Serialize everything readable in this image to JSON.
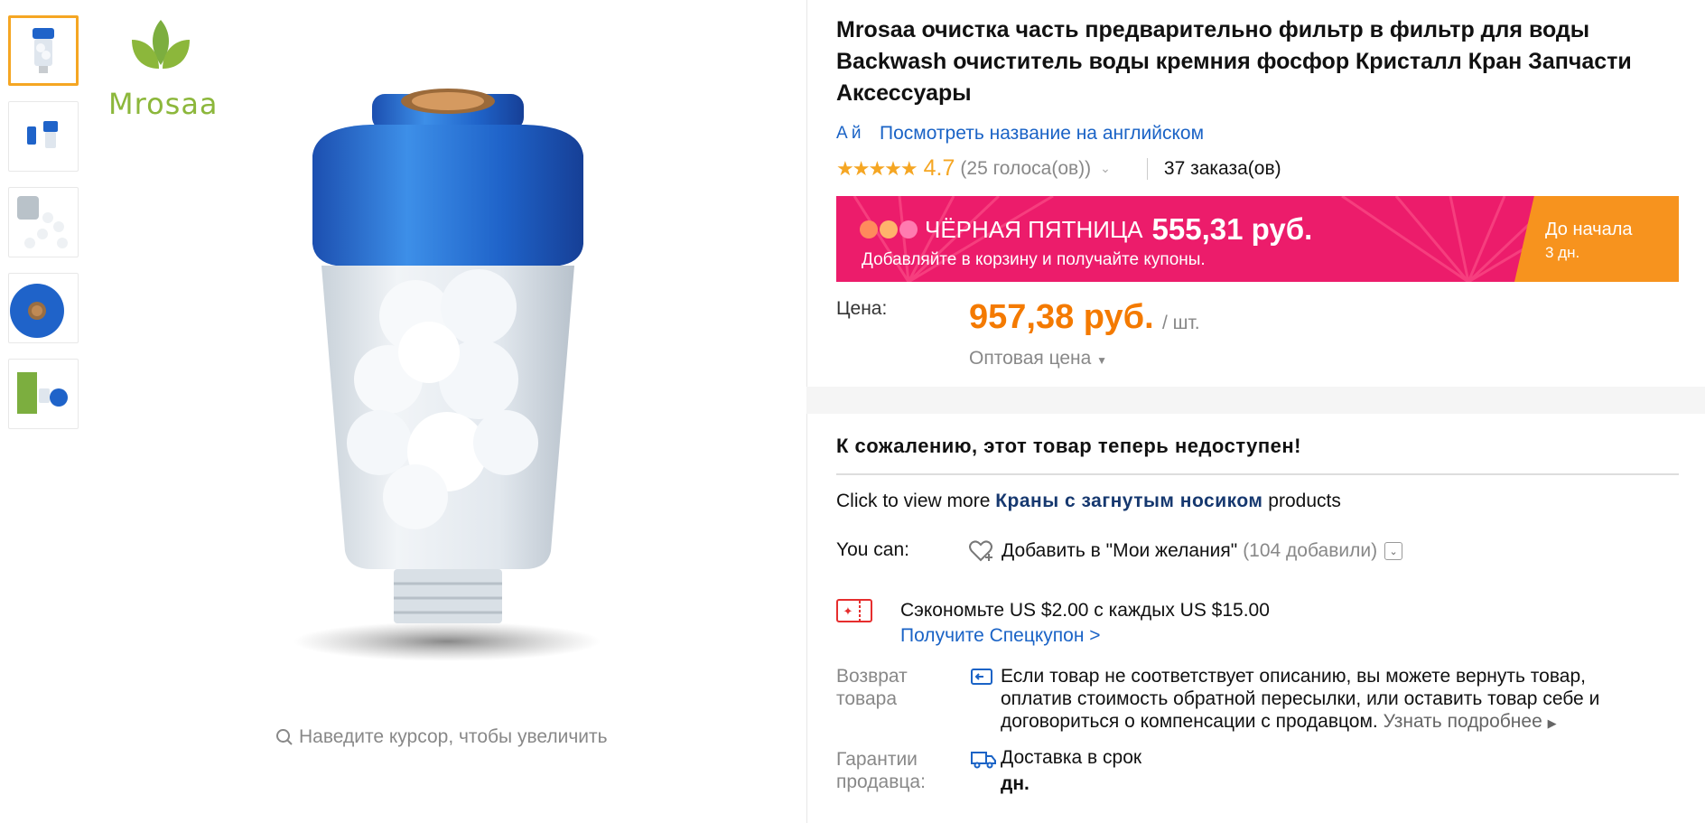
{
  "brand": {
    "name": "Mrosaa"
  },
  "gallery": {
    "thumbnails": [
      "thumb-1",
      "thumb-2",
      "thumb-3",
      "thumb-4",
      "thumb-5"
    ],
    "zoom_hint": "Наведите курсор, чтобы увеличить"
  },
  "product": {
    "title": "Mrosaa очистка часть предварительно фильтр в фильтр для воды Backwash очиститель воды кремния фосфор Кристалл Кран Запчасти Аксессуары",
    "translate_link": "Посмотреть название на английском",
    "translate_icon_text": "A й",
    "rating": {
      "stars": "★★★★★",
      "value": "4.7",
      "votes": "(25 голоса(ов))",
      "orders": "37 заказа(ов)"
    }
  },
  "promo": {
    "label": "ЧЁРНАЯ ПЯТНИЦА",
    "price": "555,31 руб.",
    "subtitle": "Добавляйте в корзину и получайте купоны.",
    "timer_label": "До начала",
    "timer_value": "3 дн.",
    "colors": {
      "banner": "#ec1c6b",
      "timer": "#f7931e"
    }
  },
  "price": {
    "label": "Цена:",
    "value": "957,38 руб.",
    "unit": "/ шт.",
    "wholesale": "Оптовая цена"
  },
  "availability": {
    "unavailable_message": "К сожалению, этот товар теперь недоступен!",
    "more_prefix": "Click to view more",
    "more_link": "Краны с загнутым носиком",
    "more_suffix": "products"
  },
  "wishlist": {
    "you_can": "You can:",
    "add_label": "Добавить в \"Мои желания\"",
    "count": "(104 добавили)"
  },
  "coupon": {
    "text": "Сэкономьте US $2.00 с каждых US $15.00",
    "link": "Получите Спецкупон >"
  },
  "returns": {
    "label": "Возврат товара",
    "text": "Если товар не соответствует описанию, вы можете вернуть товар, оплатив стоимость обратной пересылки, или оставить товар себе и договориться о компенсации с продавцом.",
    "more": "Узнать подробнее"
  },
  "guarantee": {
    "label": "Гарантии продавца:",
    "text": "Доставка в срок",
    "days": "дн."
  }
}
